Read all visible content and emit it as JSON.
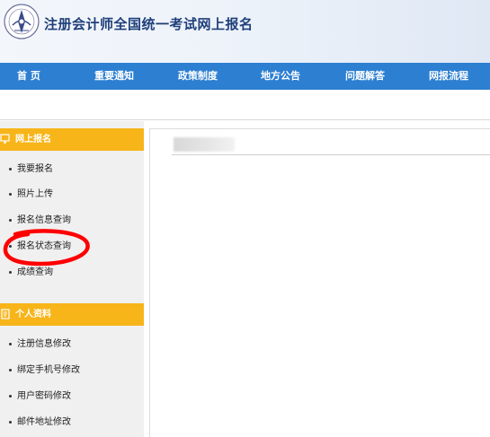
{
  "header": {
    "title": "注册会计师全国统一考试网上报名",
    "logo_icon": "cicpa-emblem-icon"
  },
  "nav": {
    "items": [
      {
        "label": "首  页"
      },
      {
        "label": "重要通知"
      },
      {
        "label": "政策制度"
      },
      {
        "label": "地方公告"
      },
      {
        "label": "问题解答"
      },
      {
        "label": "网报流程"
      }
    ]
  },
  "sidebar": {
    "sections": [
      {
        "title": "网上报名",
        "icon": "monitor-icon",
        "items": [
          "我要报名",
          "照片上传",
          "报名信息查询",
          "报名状态查询",
          "成绩查询"
        ]
      },
      {
        "title": "个人资料",
        "icon": "document-icon",
        "items": [
          "注册信息修改",
          "绑定手机号修改",
          "用户密码修改",
          "邮件地址修改"
        ]
      }
    ]
  },
  "colors": {
    "nav_bg": "#2d7fd1",
    "section_header": "#f7b51a",
    "sidebar_bg": "#f0f0f0",
    "annotation": "#ff0000",
    "title": "#1f3f7a"
  }
}
